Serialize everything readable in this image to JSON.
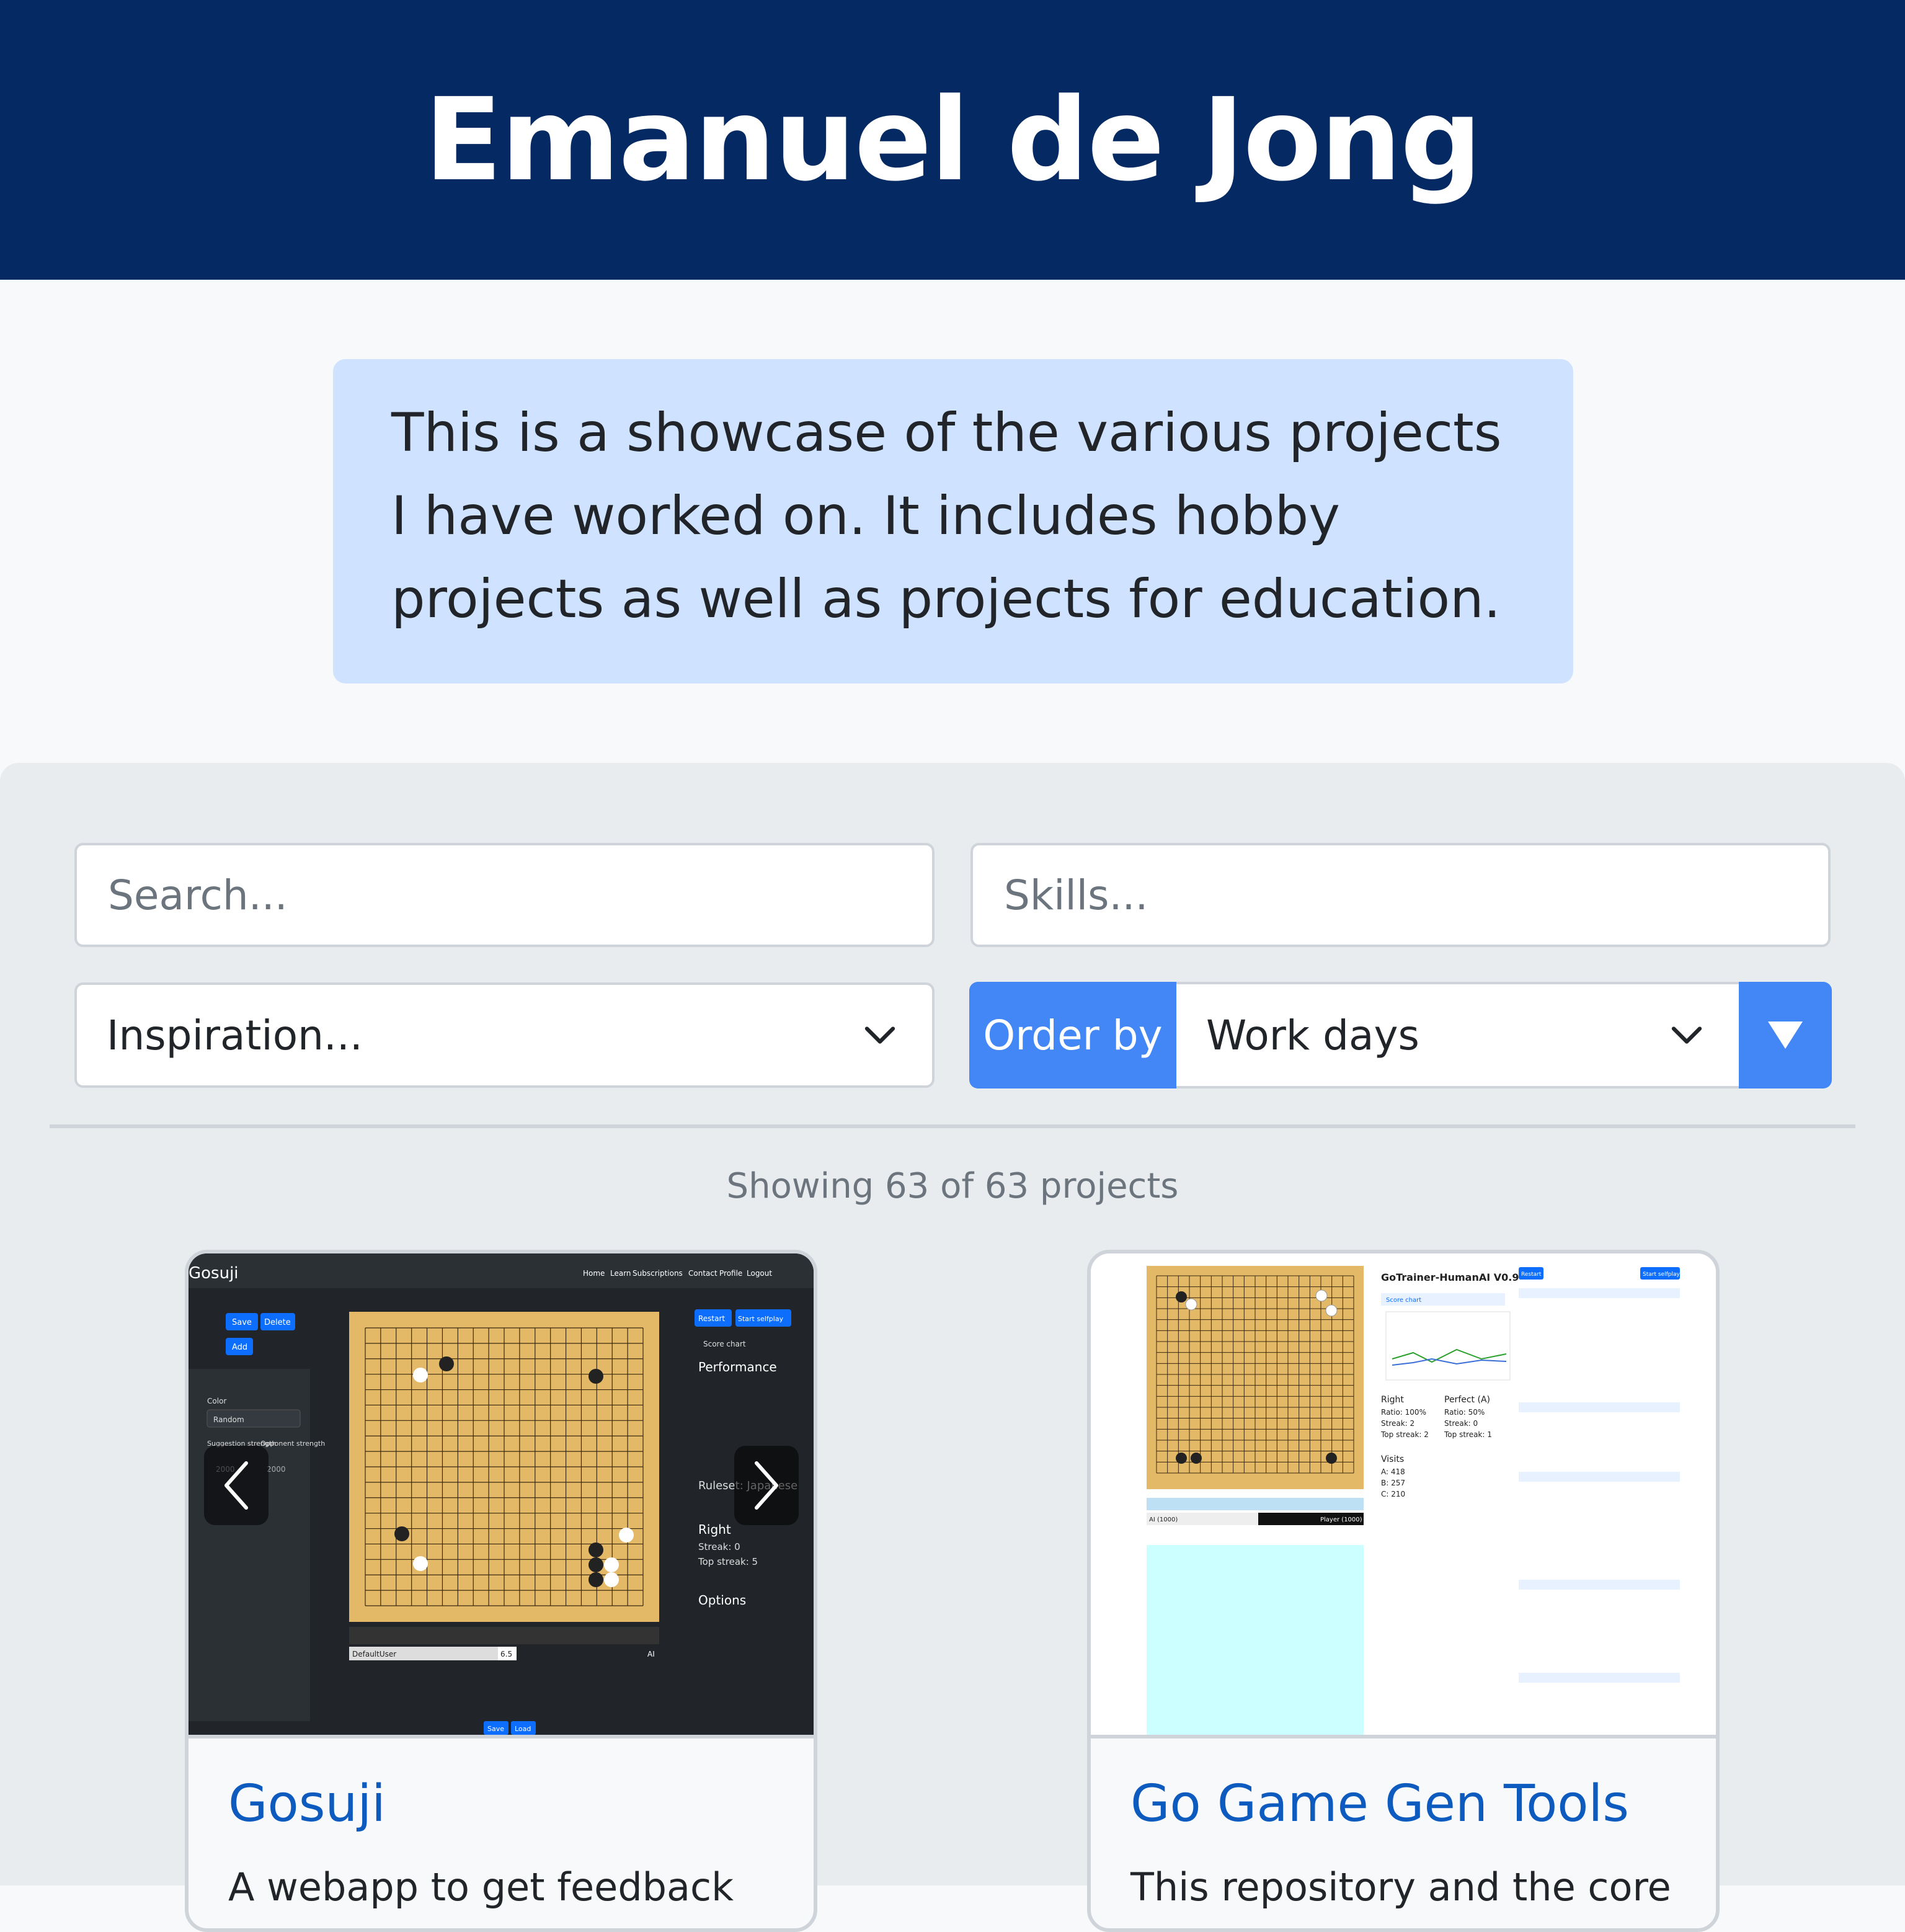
{
  "header": {
    "title": "Emanuel de Jong"
  },
  "intro": {
    "text": "This is a showcase of the various projects I have worked on. It includes hobby projects as well as projects for education."
  },
  "filters": {
    "search_placeholder": "Search...",
    "skills_placeholder": "Skills...",
    "inspiration_placeholder": "Inspiration...",
    "order_label": "Order by",
    "order_value": "Work days",
    "order_direction_icon": "triangle-down-icon"
  },
  "results": {
    "count_text": "Showing 63 of 63 projects"
  },
  "projects": [
    {
      "title": "Gosuji",
      "description": "A webapp to get feedback",
      "screenshot": {
        "app_name": "Gosuji",
        "nav": [
          "Home",
          "Learn",
          "Subscriptions",
          "Contact",
          "Profile",
          "Logout"
        ],
        "buttons": [
          "Save",
          "Delete",
          "Add",
          "Restart",
          "Start selfplay",
          "Save",
          "Load"
        ],
        "labels": [
          "Score chart",
          "Performance",
          "Right",
          "Streak: 0",
          "Top streak: 5",
          "Options",
          "Color",
          "Random",
          "Suggestion strength",
          "Opponent strength",
          "2000",
          "2000",
          "DefaultUser",
          "6.5",
          "AI",
          "Ruleset: Japanese"
        ]
      }
    },
    {
      "title": "Go Game Gen Tools",
      "description": "This repository and the core",
      "screenshot": {
        "app_name": "GoTrainer-HumanAI V0.9",
        "buttons": [
          "Restart",
          "Start selfplay"
        ],
        "labels": [
          "Score chart",
          "Right",
          "Ratio: 100%",
          "Streak: 2",
          "Top streak: 2",
          "Perfect (A)",
          "Ratio: 50%",
          "Streak: 0",
          "Top streak: 1",
          "Visits",
          "A: 418",
          "B: 257",
          "C: 210",
          "AI (1000)",
          "Player (1000)"
        ]
      }
    }
  ],
  "colors": {
    "header_bg": "#052a63",
    "intro_bg": "#cfe2ff",
    "accent": "#4287f5",
    "link": "#0d5bbf",
    "panel_bg": "#e9ecef"
  }
}
